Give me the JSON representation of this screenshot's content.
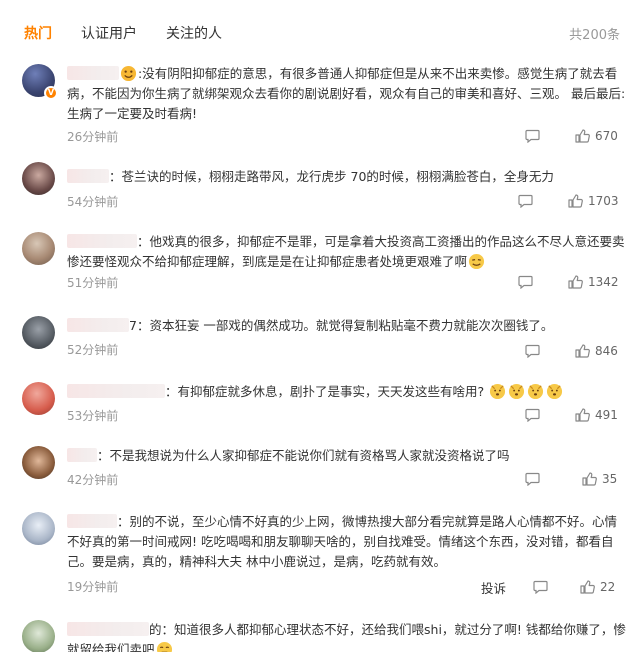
{
  "tabs": {
    "hot": "热门",
    "verified": "认证用户",
    "following": "关注的人"
  },
  "total": "共200条",
  "comments": [
    {
      "prefix": ":",
      "text": "没有阴阳抑郁症的意思，有很多普通人抑郁症但是从来不出来卖惨。感觉生病了就去看病，不能因为你生病了就绑架观众去看你的剧说剧好看，观众有自己的审美和喜好、三观。 最后最后:生病了一定要及时看病!",
      "time": "26分钟前",
      "likes": "670"
    },
    {
      "prefix": "：",
      "text": "苍兰诀的时候，栩栩走路带风，龙行虎步 70的时候，栩栩满脸苍白，全身无力",
      "time": "54分钟前",
      "likes": "1703"
    },
    {
      "prefix": "：",
      "text": "他戏真的很多，抑郁症不是罪，可是拿着大投资高工资播出的作品这么不尽人意还要卖惨还要怪观众不给抑郁症理解，到底是是在让抑郁症患者处境更艰难了啊",
      "time": "51分钟前",
      "likes": "1342"
    },
    {
      "prefix": "7：",
      "text": "资本狂妄 一部戏的偶然成功。就觉得复制粘贴毫不费力就能次次圈钱了。",
      "time": "52分钟前",
      "likes": "846"
    },
    {
      "prefix": "：",
      "text": "有抑郁症就多休息，剧扑了是事实，天天发这些有啥用?",
      "time": "53分钟前",
      "likes": "491"
    },
    {
      "prefix": "：",
      "text": "不是我想说为什么人家抑郁症不能说你们就有资格骂人家就没资格说了吗",
      "time": "42分钟前",
      "likes": "35"
    },
    {
      "prefix": "：",
      "text": "别的不说，至少心情不好真的少上网，微博热搜大部分看完就算是路人心情都不好。心情不好真的第一时间戒网! 吃吃喝喝和朋友聊聊天啥的，别自找难受。情绪这个东西，没对错，都看自己。要是病，真的，精神科大夫 林中小鹿说过，是病，吃药就有效。",
      "time": "19分钟前",
      "likes": "22",
      "report": "投诉"
    },
    {
      "prefix": "的：",
      "text": "知道很多人都抑郁心理状态不好，还给我们喂shi，就过分了啊! 钱都给你赚了，惨就留给我们卖吧"
    }
  ],
  "colors": {
    "accent": "#ff8200",
    "meta": "#999999",
    "text": "#333333"
  },
  "icons": {
    "like": "thumbs-up-icon",
    "reply": "speech-bubble-icon",
    "verified": "verified-badge-icon",
    "emoji": "smiley-emoji-icon"
  }
}
